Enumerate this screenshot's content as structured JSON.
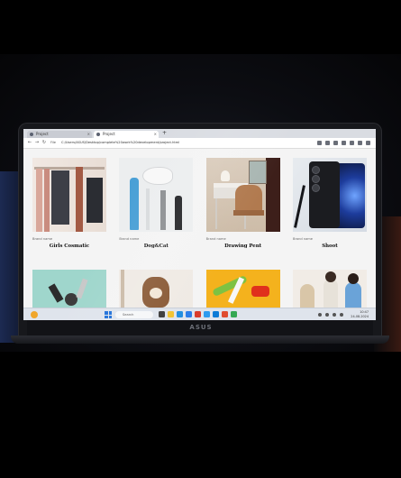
{
  "browser": {
    "tabs": [
      {
        "label": "Project"
      },
      {
        "label": "Project"
      }
    ],
    "new_tab": "+",
    "file_label": "File",
    "url": "C:/Users/ASUS/Desktop/complete%20work%20development/project.html"
  },
  "products": [
    {
      "brand": "Brand name",
      "title": "Girls Cosmatic",
      "image": "wardrobe-cosmetics"
    },
    {
      "brand": "Brand name",
      "title": "Dog&Cat",
      "image": "pet-grooming-tools"
    },
    {
      "brand": "Brand name",
      "title": "Drawing Pent",
      "image": "desk-and-chair"
    },
    {
      "brand": "Brand name",
      "title": "Shoot",
      "image": "smartphone"
    }
  ],
  "products_row2": [
    {
      "image": "makeup-brushes"
    },
    {
      "image": "dog-portrait"
    },
    {
      "image": "paint-and-toy-car"
    },
    {
      "image": "fashion-models"
    }
  ],
  "taskbar": {
    "search_label": "Search",
    "time": "10:47",
    "date": "24-08-2024"
  },
  "laptop": {
    "brand": "ASUS"
  },
  "colors": {
    "screen_bg": "#f4f4f4",
    "taskbar": "#dfe4ec",
    "bezel": "#17181c"
  }
}
